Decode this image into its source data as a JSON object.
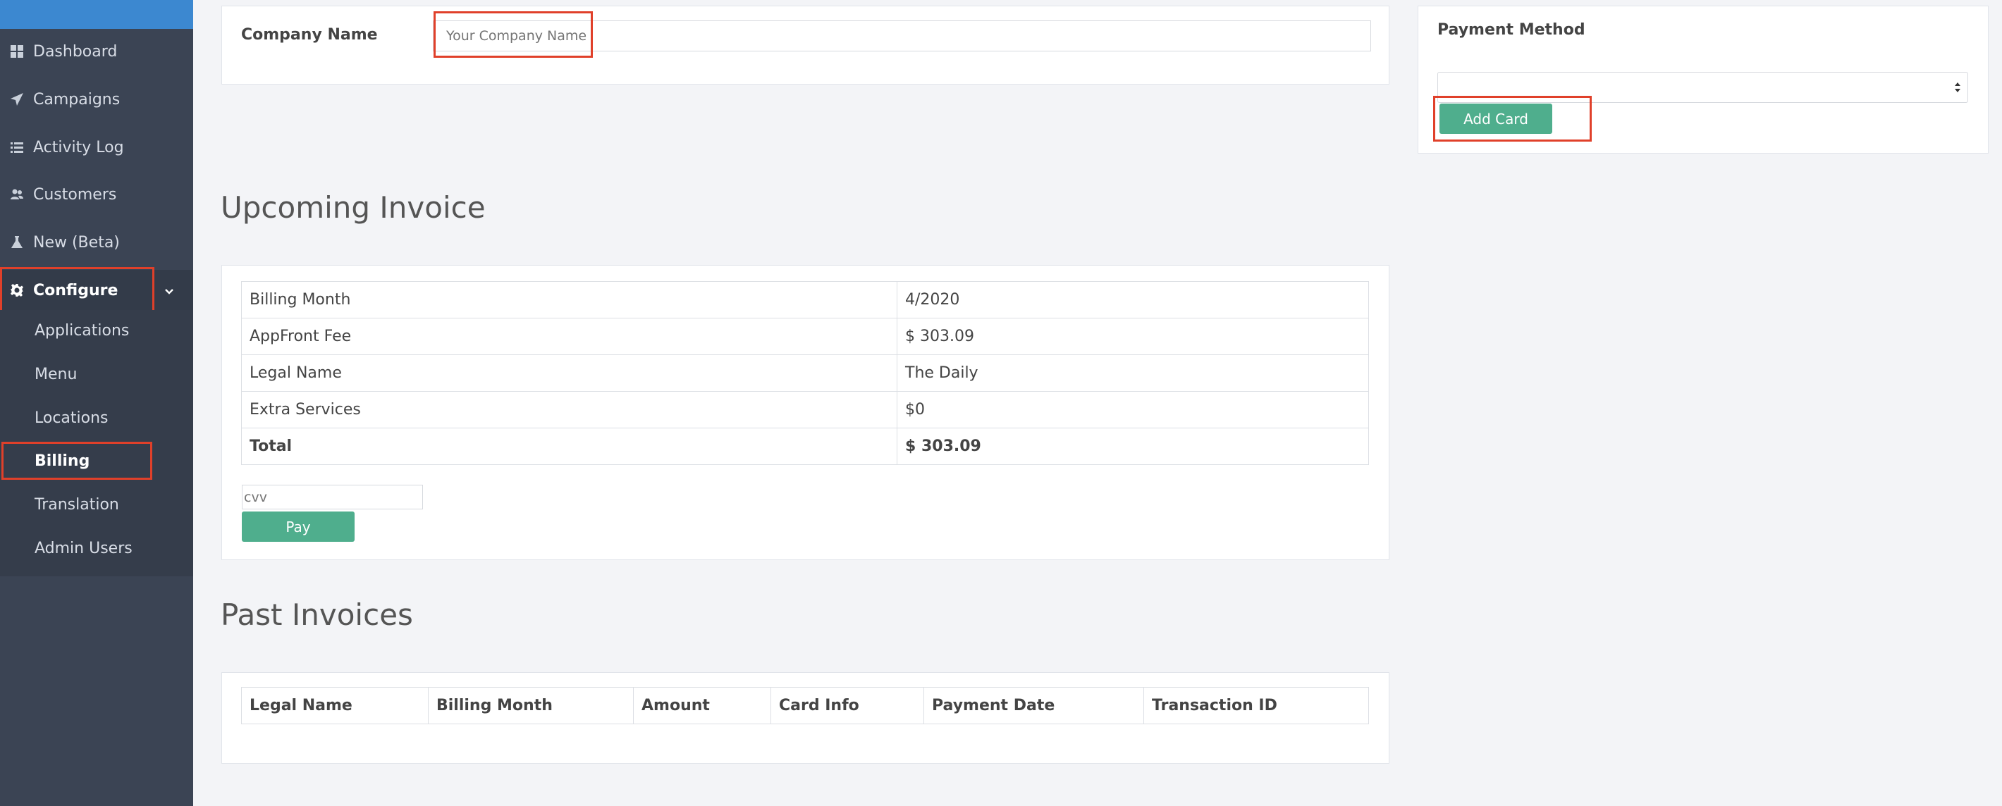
{
  "sidebar": {
    "items": [
      {
        "label": "Dashboard",
        "icon": "dashboard-icon"
      },
      {
        "label": "Campaigns",
        "icon": "paper-plane-icon"
      },
      {
        "label": "Activity Log",
        "icon": "list-icon"
      },
      {
        "label": "Customers",
        "icon": "users-icon"
      },
      {
        "label": "New (Beta)",
        "icon": "flask-icon"
      },
      {
        "label": "Configure",
        "icon": "gear-icon"
      }
    ],
    "submenu": [
      "Applications",
      "Menu",
      "Locations",
      "Billing",
      "Translation",
      "Admin Users"
    ],
    "active_submenu": "Billing"
  },
  "company": {
    "label": "Company Name",
    "placeholder": "Your Company Name"
  },
  "payment": {
    "title": "Payment Method",
    "select_value": "",
    "add_card_label": "Add Card"
  },
  "upcoming": {
    "title": "Upcoming Invoice",
    "rows": [
      {
        "key": "Billing Month",
        "value": "4/2020"
      },
      {
        "key": "AppFront Fee",
        "value": "$ 303.09"
      },
      {
        "key": "Legal Name",
        "value": "The Daily"
      },
      {
        "key": "Extra Services",
        "value": "$0"
      },
      {
        "key": "Total",
        "value": "$ 303.09"
      }
    ],
    "cvv_placeholder": "cvv",
    "pay_label": "Pay"
  },
  "past": {
    "title": "Past Invoices",
    "columns": [
      "Legal Name",
      "Billing Month",
      "Amount",
      "Card Info",
      "Payment Date",
      "Transaction ID"
    ]
  },
  "colors": {
    "sidebar_bg": "#3b4454",
    "accent_blue": "#3c88d0",
    "button_green": "#4fae8d",
    "highlight_red": "#e0402a"
  }
}
